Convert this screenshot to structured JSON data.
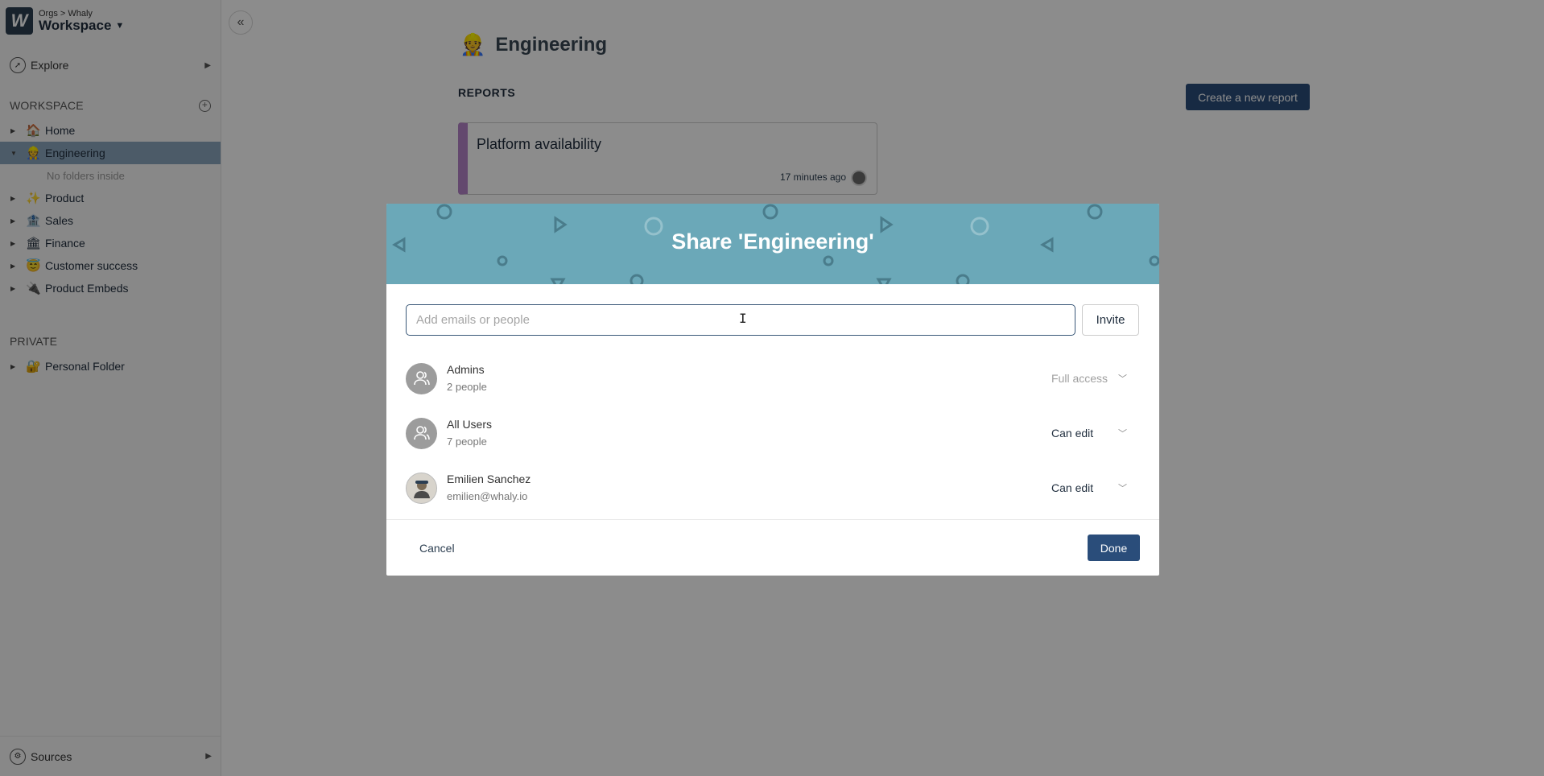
{
  "org": {
    "breadcrumb": "Orgs > Whaly",
    "name": "Workspace",
    "logo_letter": "W"
  },
  "sidebar": {
    "explore_label": "Explore",
    "workspace_title": "WORKSPACE",
    "items": [
      {
        "label": "Home",
        "icon": "🏠"
      },
      {
        "label": "Engineering",
        "icon": "👷"
      },
      {
        "label": "Product",
        "icon": "✨"
      },
      {
        "label": "Sales",
        "icon": "🏦"
      },
      {
        "label": "Finance",
        "icon": "🏛"
      },
      {
        "label": "Customer success",
        "icon": "😇"
      },
      {
        "label": "Product Embeds",
        "icon": "🔌"
      }
    ],
    "no_folders_text": "No folders inside",
    "private_title": "PRIVATE",
    "private_items": [
      {
        "label": "Personal Folder",
        "icon": "🔐"
      }
    ],
    "sources_label": "Sources"
  },
  "main": {
    "title": "Engineering",
    "title_icon": "👷",
    "reports_label": "REPORTS",
    "create_button": "Create a new report",
    "report": {
      "name": "Platform availability",
      "time": "17 minutes ago"
    }
  },
  "modal": {
    "title": "Share 'Engineering'",
    "input_placeholder": "Add emails or people",
    "invite_button": "Invite",
    "members": [
      {
        "name": "Admins",
        "sub": "2 people",
        "permission": "Full access"
      },
      {
        "name": "All Users",
        "sub": "7 people",
        "permission": "Can edit"
      },
      {
        "name": "Emilien Sanchez",
        "sub": "emilien@whaly.io",
        "permission": "Can edit"
      }
    ],
    "cancel_button": "Cancel",
    "done_button": "Done"
  },
  "colors": {
    "accent": "#2a4d7a",
    "modal_header": "#6ba8b8",
    "active_sidebar": "#8aa6bd",
    "report_stripe": "#b584c8"
  }
}
